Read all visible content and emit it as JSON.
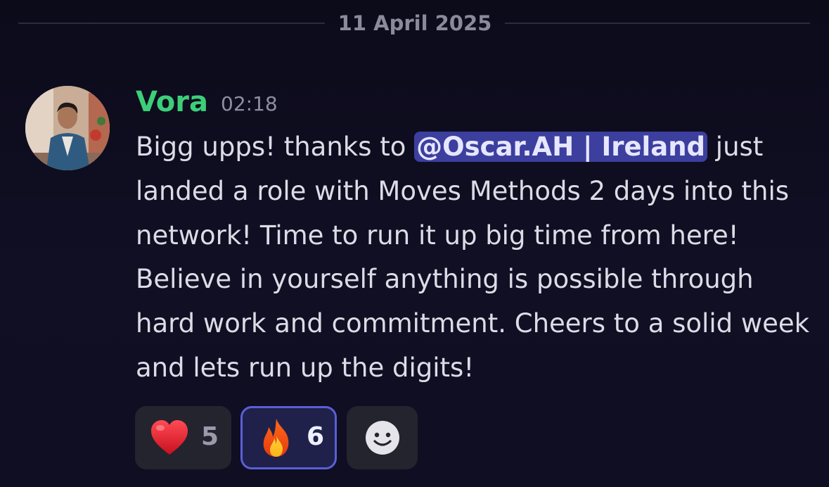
{
  "date_divider": {
    "label": "11 April 2025"
  },
  "message": {
    "author": "Vora",
    "timestamp": "02:18",
    "text_before": "Bigg upps! thanks to ",
    "mention": "@Oscar.AH | Ireland",
    "text_after": " just landed a role with Moves Methods 2 days into this network! Time to run it up big time from here! Believe in yourself anything is possible through hard work and commitment. Cheers to a solid week and lets run up the digits!",
    "author_color": "#3ccf78",
    "mention_bg": "#3c3f9e"
  },
  "reactions": [
    {
      "icon": "red-heart-icon",
      "count": "5",
      "selected": false
    },
    {
      "icon": "fire-icon",
      "count": "6",
      "selected": true
    },
    {
      "icon": "add-reaction-smiley-icon",
      "count": "",
      "selected": false
    }
  ]
}
